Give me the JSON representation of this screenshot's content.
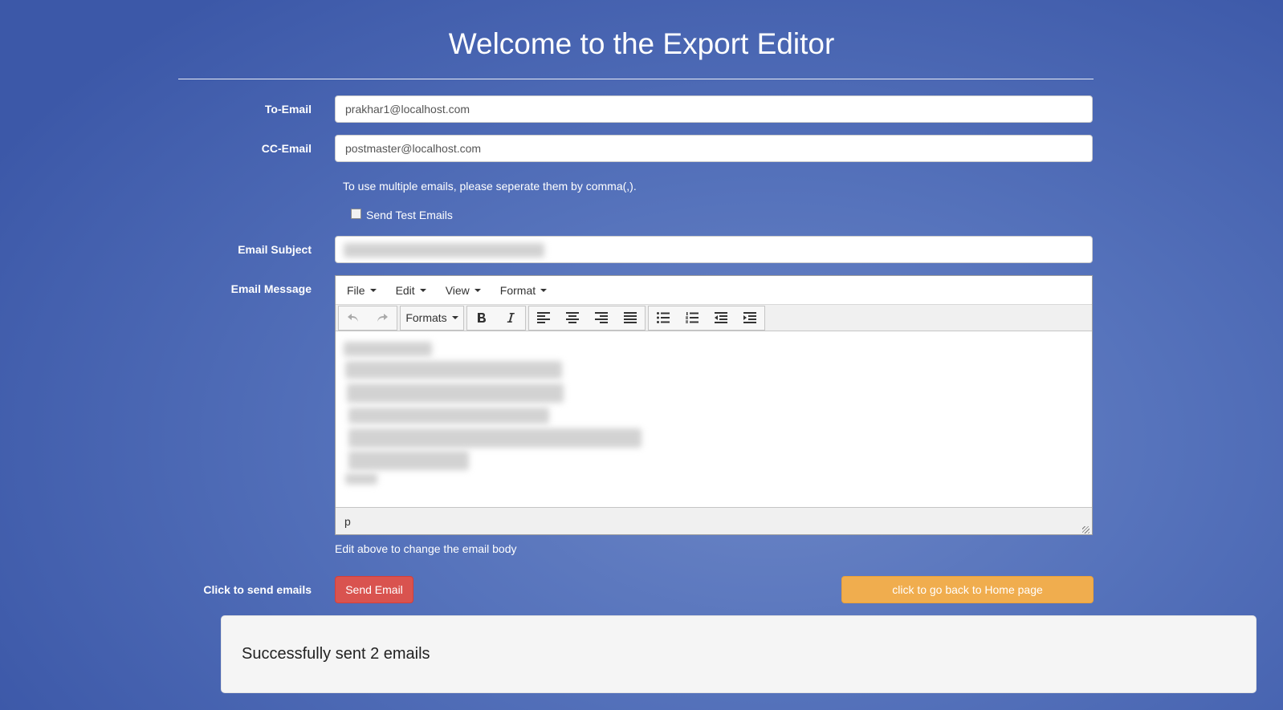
{
  "header": {
    "title": "Welcome to the Export Editor"
  },
  "form": {
    "to_email": {
      "label": "To-Email",
      "value": "prakhar1@localhost.com"
    },
    "cc_email": {
      "label": "CC-Email",
      "value": "postmaster@localhost.com"
    },
    "multi_email_help": "To use multiple emails, please seperate them by comma(,).",
    "test_emails_checkbox": {
      "label": "Send Test Emails",
      "checked": false
    },
    "subject": {
      "label": "Email Subject",
      "value": ""
    },
    "message": {
      "label": "Email Message",
      "help": "Edit above to change the email body"
    },
    "send": {
      "label": "Click to send emails",
      "button": "Send Email"
    },
    "home_button": "click to go back to Home page"
  },
  "editor": {
    "menus": [
      "File",
      "Edit",
      "View",
      "Format"
    ],
    "toolbar": {
      "formats_label": "Formats",
      "buttons": [
        "undo-icon",
        "redo-icon",
        "bold-icon",
        "italic-icon",
        "align-left-icon",
        "align-center-icon",
        "align-right-icon",
        "align-justify-icon",
        "bullet-list-icon",
        "numbered-list-icon",
        "outdent-icon",
        "indent-icon"
      ]
    },
    "status_path": "p"
  },
  "result": {
    "message": "Successfully sent 2 emails"
  },
  "colors": {
    "background": "#5572bb",
    "danger": "#d9534f",
    "warning": "#f0ad4e",
    "well": "#f5f5f5"
  }
}
